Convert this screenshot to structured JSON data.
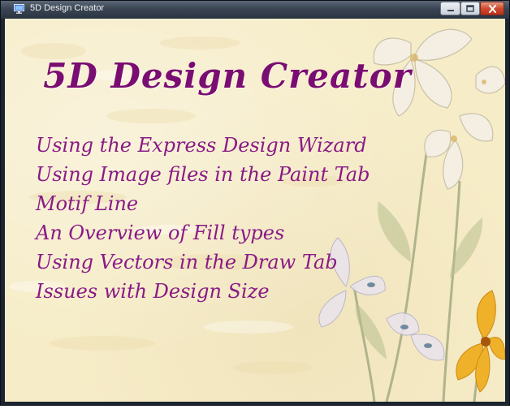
{
  "window": {
    "title": "5D Design Creator",
    "controls": {
      "minimize_icon": "minimize-icon",
      "maximize_icon": "maximize-icon",
      "close_icon": "close-icon"
    }
  },
  "main": {
    "heading": "5D Design Creator",
    "menu_items": [
      {
        "label": "Using the Express Design Wizard"
      },
      {
        "label": "Using Image files in the Paint Tab"
      },
      {
        "label": "Motif Line"
      },
      {
        "label": "An Overview of Fill types"
      },
      {
        "label": "Using Vectors in the Draw Tab"
      },
      {
        "label": "Issues with Design Size"
      }
    ]
  },
  "colors": {
    "title_text": "#7a0d72",
    "menu_text": "#8a1a86",
    "background": "#f6ecc7",
    "titlebar": "#3a4554"
  }
}
